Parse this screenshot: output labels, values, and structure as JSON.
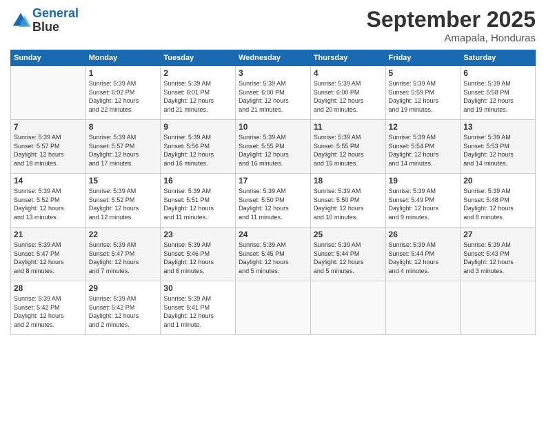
{
  "logo": {
    "line1": "General",
    "line2": "Blue"
  },
  "title": "September 2025",
  "location": "Amapala, Honduras",
  "days_of_week": [
    "Sunday",
    "Monday",
    "Tuesday",
    "Wednesday",
    "Thursday",
    "Friday",
    "Saturday"
  ],
  "weeks": [
    [
      {
        "day": "",
        "info": ""
      },
      {
        "day": "1",
        "info": "Sunrise: 5:39 AM\nSunset: 6:02 PM\nDaylight: 12 hours\nand 22 minutes."
      },
      {
        "day": "2",
        "info": "Sunrise: 5:39 AM\nSunset: 6:01 PM\nDaylight: 12 hours\nand 21 minutes."
      },
      {
        "day": "3",
        "info": "Sunrise: 5:39 AM\nSunset: 6:00 PM\nDaylight: 12 hours\nand 21 minutes."
      },
      {
        "day": "4",
        "info": "Sunrise: 5:39 AM\nSunset: 6:00 PM\nDaylight: 12 hours\nand 20 minutes."
      },
      {
        "day": "5",
        "info": "Sunrise: 5:39 AM\nSunset: 5:59 PM\nDaylight: 12 hours\nand 19 minutes."
      },
      {
        "day": "6",
        "info": "Sunrise: 5:39 AM\nSunset: 5:58 PM\nDaylight: 12 hours\nand 19 minutes."
      }
    ],
    [
      {
        "day": "7",
        "info": "Sunrise: 5:39 AM\nSunset: 5:57 PM\nDaylight: 12 hours\nand 18 minutes."
      },
      {
        "day": "8",
        "info": "Sunrise: 5:39 AM\nSunset: 5:57 PM\nDaylight: 12 hours\nand 17 minutes."
      },
      {
        "day": "9",
        "info": "Sunrise: 5:39 AM\nSunset: 5:56 PM\nDaylight: 12 hours\nand 16 minutes."
      },
      {
        "day": "10",
        "info": "Sunrise: 5:39 AM\nSunset: 5:55 PM\nDaylight: 12 hours\nand 16 minutes."
      },
      {
        "day": "11",
        "info": "Sunrise: 5:39 AM\nSunset: 5:55 PM\nDaylight: 12 hours\nand 15 minutes."
      },
      {
        "day": "12",
        "info": "Sunrise: 5:39 AM\nSunset: 5:54 PM\nDaylight: 12 hours\nand 14 minutes."
      },
      {
        "day": "13",
        "info": "Sunrise: 5:39 AM\nSunset: 5:53 PM\nDaylight: 12 hours\nand 14 minutes."
      }
    ],
    [
      {
        "day": "14",
        "info": "Sunrise: 5:39 AM\nSunset: 5:52 PM\nDaylight: 12 hours\nand 13 minutes."
      },
      {
        "day": "15",
        "info": "Sunrise: 5:39 AM\nSunset: 5:52 PM\nDaylight: 12 hours\nand 12 minutes."
      },
      {
        "day": "16",
        "info": "Sunrise: 5:39 AM\nSunset: 5:51 PM\nDaylight: 12 hours\nand 11 minutes."
      },
      {
        "day": "17",
        "info": "Sunrise: 5:39 AM\nSunset: 5:50 PM\nDaylight: 12 hours\nand 11 minutes."
      },
      {
        "day": "18",
        "info": "Sunrise: 5:39 AM\nSunset: 5:50 PM\nDaylight: 12 hours\nand 10 minutes."
      },
      {
        "day": "19",
        "info": "Sunrise: 5:39 AM\nSunset: 5:49 PM\nDaylight: 12 hours\nand 9 minutes."
      },
      {
        "day": "20",
        "info": "Sunrise: 5:39 AM\nSunset: 5:48 PM\nDaylight: 12 hours\nand 8 minutes."
      }
    ],
    [
      {
        "day": "21",
        "info": "Sunrise: 5:39 AM\nSunset: 5:47 PM\nDaylight: 12 hours\nand 8 minutes."
      },
      {
        "day": "22",
        "info": "Sunrise: 5:39 AM\nSunset: 5:47 PM\nDaylight: 12 hours\nand 7 minutes."
      },
      {
        "day": "23",
        "info": "Sunrise: 5:39 AM\nSunset: 5:46 PM\nDaylight: 12 hours\nand 6 minutes."
      },
      {
        "day": "24",
        "info": "Sunrise: 5:39 AM\nSunset: 5:45 PM\nDaylight: 12 hours\nand 5 minutes."
      },
      {
        "day": "25",
        "info": "Sunrise: 5:39 AM\nSunset: 5:44 PM\nDaylight: 12 hours\nand 5 minutes."
      },
      {
        "day": "26",
        "info": "Sunrise: 5:39 AM\nSunset: 5:44 PM\nDaylight: 12 hours\nand 4 minutes."
      },
      {
        "day": "27",
        "info": "Sunrise: 5:39 AM\nSunset: 5:43 PM\nDaylight: 12 hours\nand 3 minutes."
      }
    ],
    [
      {
        "day": "28",
        "info": "Sunrise: 5:39 AM\nSunset: 5:42 PM\nDaylight: 12 hours\nand 2 minutes."
      },
      {
        "day": "29",
        "info": "Sunrise: 5:39 AM\nSunset: 5:42 PM\nDaylight: 12 hours\nand 2 minutes."
      },
      {
        "day": "30",
        "info": "Sunrise: 5:39 AM\nSunset: 5:41 PM\nDaylight: 12 hours\nand 1 minute."
      },
      {
        "day": "",
        "info": ""
      },
      {
        "day": "",
        "info": ""
      },
      {
        "day": "",
        "info": ""
      },
      {
        "day": "",
        "info": ""
      }
    ]
  ]
}
